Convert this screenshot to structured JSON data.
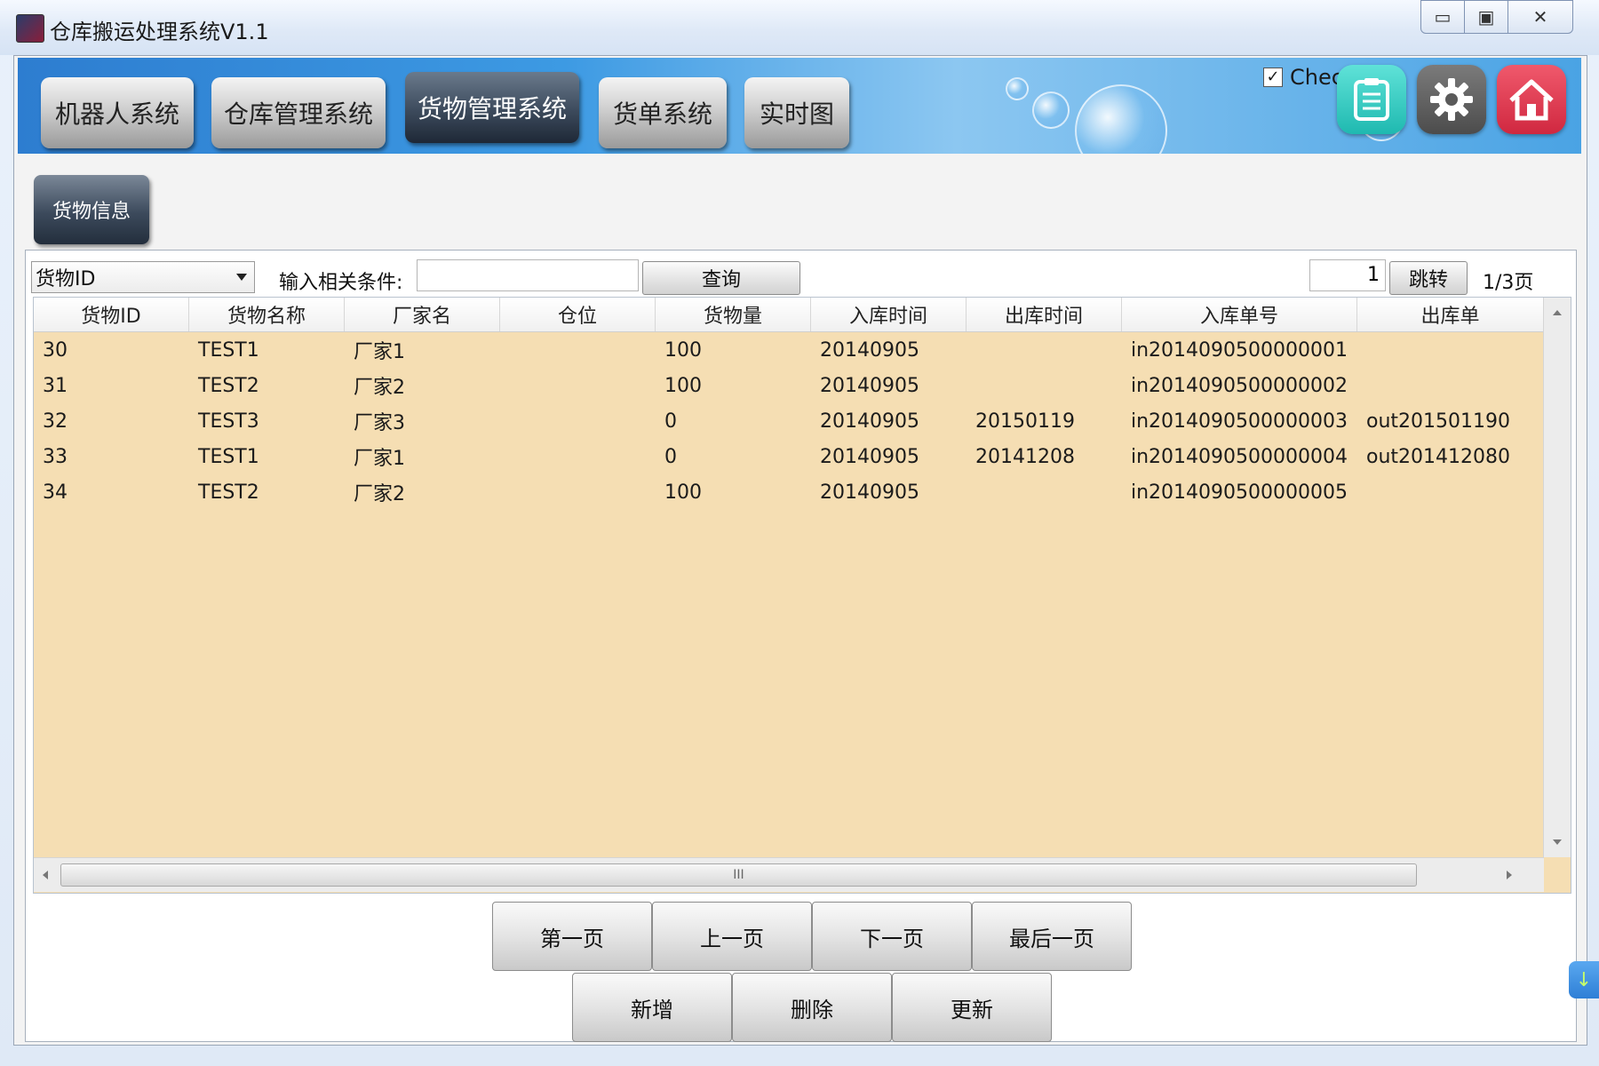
{
  "window": {
    "title": "仓库搬运处理系统V1.1",
    "controls": {
      "minimize": "▭",
      "maximize": "▣",
      "close": "✕"
    }
  },
  "nav": {
    "tabs": [
      {
        "label": "机器人系统",
        "active": false
      },
      {
        "label": "仓库管理系统",
        "active": false
      },
      {
        "label": "货物管理系统",
        "active": true
      },
      {
        "label": "货单系统",
        "active": false
      },
      {
        "label": "实时图",
        "active": false
      }
    ],
    "check_label": "Check",
    "check_checked": true,
    "check_mark": "✓",
    "tool_icons": [
      "clipboard-icon",
      "gear-icon",
      "home-icon"
    ]
  },
  "subnav": {
    "label": "货物信息"
  },
  "search": {
    "field_selected": "货物ID",
    "condition_label": "输入相关条件:",
    "condition_value": "",
    "query_label": "查询",
    "page_input": "1",
    "jump_label": "跳转",
    "page_info": "1/3页"
  },
  "table": {
    "columns": [
      "货物ID",
      "货物名称",
      "厂家名",
      "仓位",
      "货物量",
      "入库时间",
      "出库时间",
      "入库单号",
      "出库单"
    ],
    "rows": [
      [
        "30",
        "TEST1",
        "厂家1",
        "",
        "100",
        "20140905",
        "",
        "in2014090500000001",
        ""
      ],
      [
        "31",
        "TEST2",
        "厂家2",
        "",
        "100",
        "20140905",
        "",
        "in2014090500000002",
        ""
      ],
      [
        "32",
        "TEST3",
        "厂家3",
        "",
        "0",
        "20140905",
        "20150119",
        "in2014090500000003",
        "out201501190"
      ],
      [
        "33",
        "TEST1",
        "厂家1",
        "",
        "0",
        "20140905",
        "20141208",
        "in2014090500000004",
        "out201412080"
      ],
      [
        "34",
        "TEST2",
        "厂家2",
        "",
        "100",
        "20140905",
        "",
        "in2014090500000005",
        ""
      ]
    ],
    "scroll_thumb_grip": "III"
  },
  "pager": {
    "first": "第一页",
    "prev": "上一页",
    "next": "下一页",
    "last": "最后一页"
  },
  "actions": {
    "add": "新增",
    "delete": "删除",
    "update": "更新"
  },
  "side_tab_icon": "↓",
  "colors": {
    "grid_background": "#f5deb3",
    "active_tab": "#3c4a5c",
    "banner": "#3d9ae3"
  }
}
